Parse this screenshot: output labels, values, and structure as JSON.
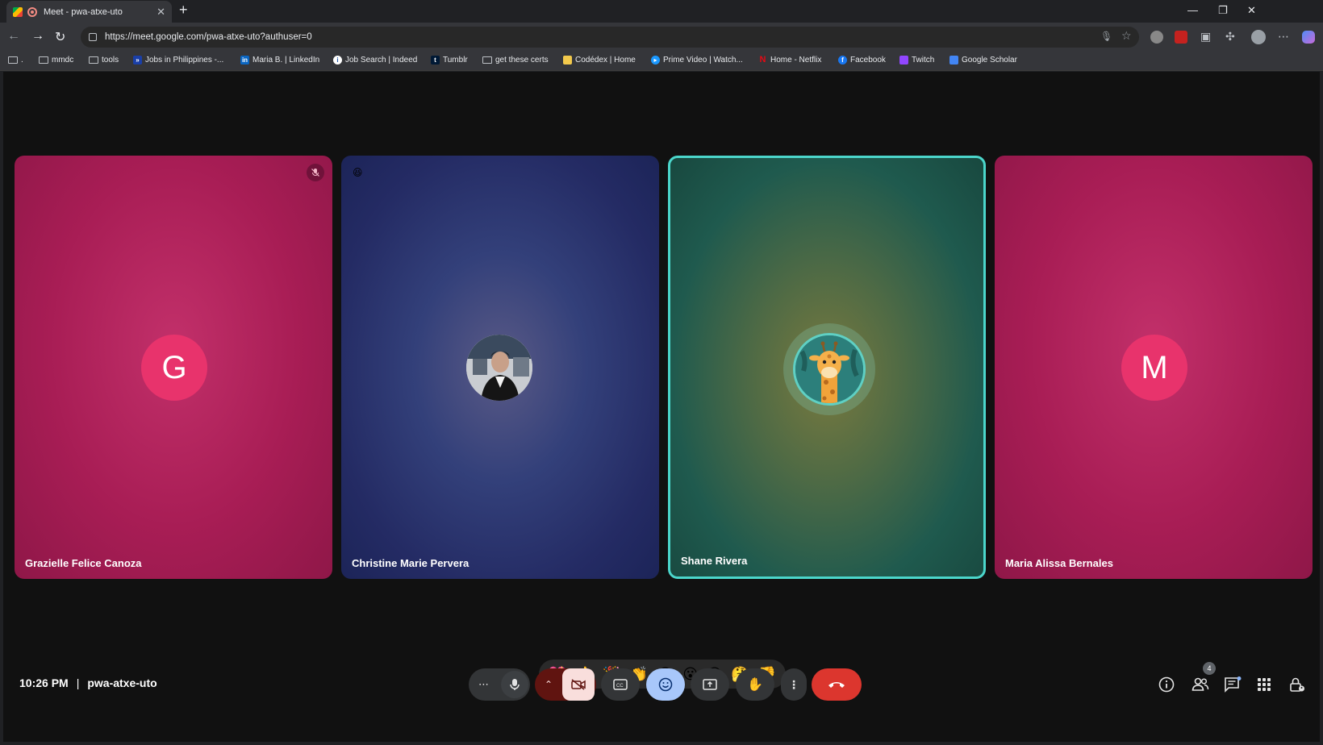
{
  "browser": {
    "tab_title": "Meet - pwa-atxe-uto",
    "url": "https://meet.google.com/pwa-atxe-uto?authuser=0",
    "bookmarks": [
      {
        "label": "mmdc",
        "icon": "folder-icon"
      },
      {
        "label": "tools",
        "icon": "folder-icon"
      },
      {
        "label": "Jobs in Philippines -...",
        "icon": "jobs-icon"
      },
      {
        "label": "Maria B. | LinkedIn",
        "icon": "linkedin-icon"
      },
      {
        "label": "Job Search | Indeed",
        "icon": "indeed-icon"
      },
      {
        "label": "Tumblr",
        "icon": "tumblr-icon"
      },
      {
        "label": "get these certs",
        "icon": "folder-icon"
      },
      {
        "label": "Codédex | Home",
        "icon": "codedex-icon"
      },
      {
        "label": "Prime Video | Watch...",
        "icon": "prime-video-icon"
      },
      {
        "label": "Home - Netflix",
        "icon": "netflix-icon"
      },
      {
        "label": "Facebook",
        "icon": "facebook-icon"
      },
      {
        "label": "Twitch",
        "icon": "twitch-icon"
      },
      {
        "label": "Google Scholar",
        "icon": "google-scholar-icon"
      }
    ]
  },
  "meet": {
    "participants": [
      {
        "name": "Grazielle Felice Canoza",
        "avatar_letter": "G",
        "muted": true
      },
      {
        "name": "Christine Marie Pervera",
        "avatar": "photo",
        "reaction": "😆"
      },
      {
        "name": "Shane Rivera",
        "avatar": "giraffe",
        "speaking": true
      },
      {
        "name": "Maria Alissa Bernales",
        "avatar_letter": "M"
      }
    ],
    "reactions": [
      "💖",
      "👍",
      "🎉",
      "👏",
      "😂",
      "😮",
      "😢",
      "🤔",
      "👎"
    ],
    "time": "10:26 PM",
    "meeting_code": "pwa-atxe-uto",
    "people_count": "4",
    "colors": {
      "speaking_border": "#4bd6cb",
      "leave_button": "#dc362e",
      "camera_off": "#f9dedc",
      "active_control": "#a8c7fa"
    }
  }
}
